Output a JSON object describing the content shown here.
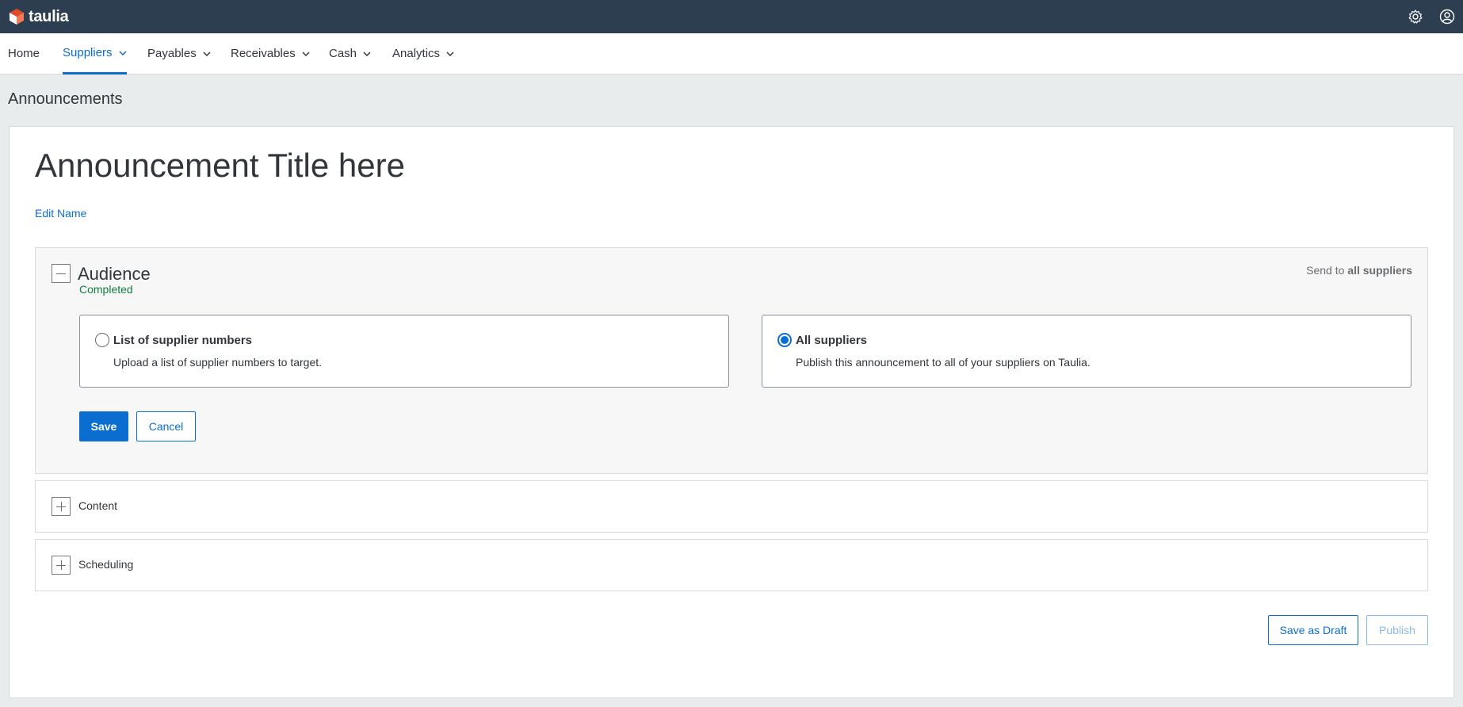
{
  "app": {
    "brand": "taulia",
    "brand_color": "#e24b2a",
    "topbar_color": "#2d3e50",
    "accent": "#0a6ed1",
    "success": "#107e3e",
    "icons": {
      "settings": "gear-icon",
      "profile": "user-icon"
    }
  },
  "nav": {
    "items": [
      {
        "label": "Home",
        "has_menu": false,
        "active": false
      },
      {
        "label": "Suppliers",
        "has_menu": true,
        "active": true
      },
      {
        "label": "Payables",
        "has_menu": true,
        "active": false
      },
      {
        "label": "Receivables",
        "has_menu": true,
        "active": false
      },
      {
        "label": "Cash",
        "has_menu": true,
        "active": false
      },
      {
        "label": "Analytics",
        "has_menu": true,
        "active": false
      }
    ]
  },
  "page": {
    "heading": "Announcements",
    "announcement_title": "Announcement Title here",
    "edit_name": "Edit Name"
  },
  "audience": {
    "title": "Audience",
    "status": "Completed",
    "send_to_prefix": "Send to",
    "send_to_value": "all suppliers",
    "options": [
      {
        "title": "List of supplier numbers",
        "description": "Upload a list of supplier numbers to target.",
        "selected": false
      },
      {
        "title": "All suppliers",
        "description": "Publish this announcement to all of your suppliers on Taulia.",
        "selected": true
      }
    ],
    "save": "Save",
    "cancel": "Cancel"
  },
  "sections": {
    "content": "Content",
    "scheduling": "Scheduling"
  },
  "footer": {
    "save_draft": "Save as Draft",
    "publish": "Publish"
  }
}
